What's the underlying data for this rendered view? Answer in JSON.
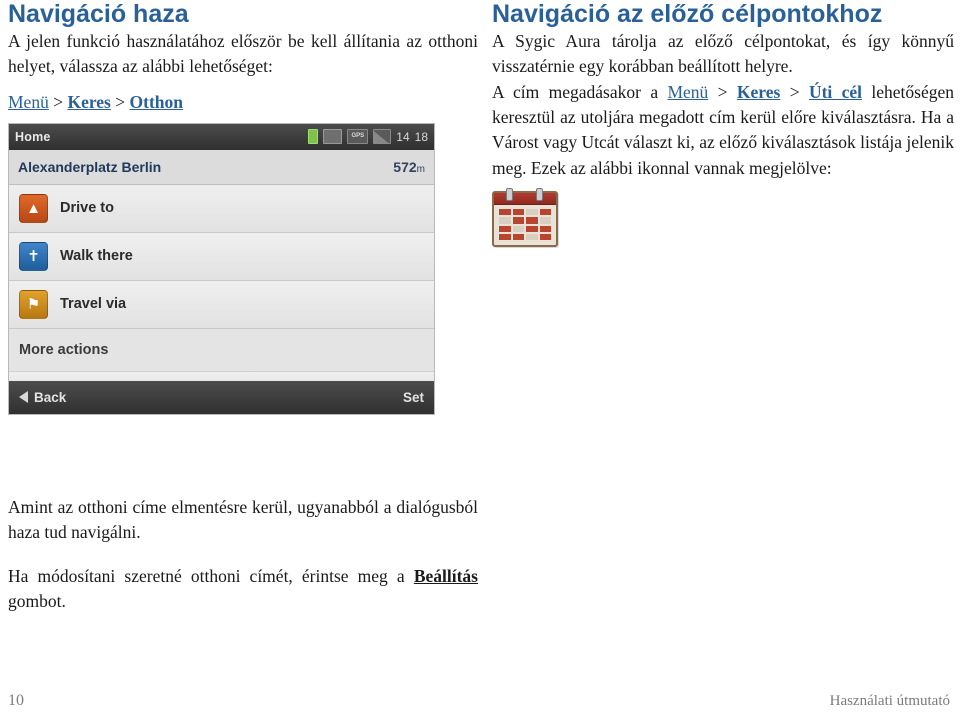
{
  "left": {
    "heading": "Navigáció haza",
    "intro": "A jelen funkció használatához először be kell állítania az otthoni helyet, válassza az alábbi lehetőséget:",
    "breadcrumb": {
      "item1": "Menü",
      "sep1": ">",
      "item2": "Keres",
      "sep2": ">",
      "item3": "Otthon"
    },
    "para1": "Amint az otthoni címe elmentésre kerül, ugyanabból a dialógusból haza tud navigálni.",
    "para2_before": "Ha módosítani szeretné otthoni címét, érintse meg a ",
    "para2_bold": "Beállítás",
    "para2_after": " gombot."
  },
  "device": {
    "title": "Home",
    "status": {
      "battery_icon": "battery-icon",
      "sd_icon": "sd-card-icon",
      "gps_label": "GPS",
      "signal_icon": "signal-bars-icon",
      "value1": "14",
      "value2": "18"
    },
    "address": "Alexanderplatz Berlin",
    "distance_value": "572",
    "distance_unit": "m",
    "items": [
      {
        "label": "Drive to",
        "icon": "car-icon",
        "glyph": "Ὡ7"
      },
      {
        "label": "Walk there",
        "icon": "pedestrian-icon",
        "glyph": "⇶"
      },
      {
        "label": "Travel via",
        "icon": "waypoint-icon",
        "glyph": "⚑"
      }
    ],
    "more_actions": "More actions",
    "back_label": "Back",
    "set_label": "Set"
  },
  "right": {
    "heading": "Navigáció az előző célpontokhoz",
    "para1": "A Sygic Aura tárolja az előző célpontokat, és így könnyű visszatérnie egy korábban beállított helyre.",
    "para2": {
      "t1": "A cím megadásakor a ",
      "link1": "Menü",
      "sep1": " > ",
      "link2": "Keres",
      "sep2": " > ",
      "link3": "Úti cél",
      "t2": " lehetőségen keresztül az utoljára megadott cím kerül előre kiválasztásra. Ha a Várost vagy Utcát választ ki, az előző kiválasztások listája jelenik meg.  Ezek az alábbi ikonnal vannak megjelölve:"
    },
    "history_icon_name": "history-calendar-icon"
  },
  "footer": {
    "page_number": "10",
    "doc_title": "Használati útmutató"
  },
  "colors": {
    "heading": "#2a6099",
    "link": "#2a6099",
    "body": "#1a1a1a",
    "footer": "#7b7b7b"
  }
}
